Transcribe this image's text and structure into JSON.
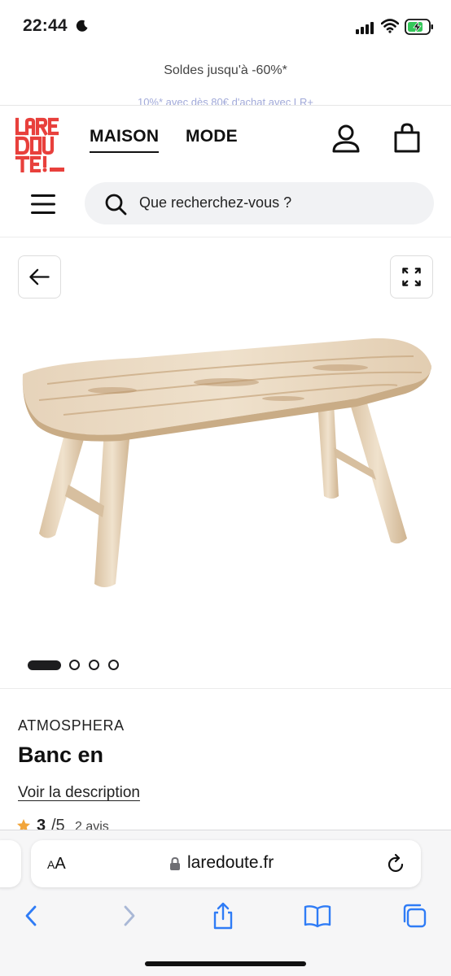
{
  "status_bar": {
    "time": "22:44",
    "icons": [
      "moon-icon",
      "cellular-signal-icon",
      "wifi-icon",
      "battery-charging-icon"
    ]
  },
  "promo": {
    "main": "Soldes jusqu'à -60%*",
    "sub": "10%* avec dès 80€ d'achat avec LR+"
  },
  "header": {
    "logo_text": "LA REDOUTE",
    "tabs": [
      {
        "label": "MAISON",
        "active": true
      },
      {
        "label": "MODE",
        "active": false
      }
    ],
    "icons": [
      "account-icon",
      "shopping-bag-icon",
      "menu-icon"
    ]
  },
  "search": {
    "placeholder": "Que recherchez-vous ?"
  },
  "gallery": {
    "image_subject": "wooden-bench",
    "total_images": 4,
    "active_index": 0,
    "icons": [
      "arrow-left-icon",
      "expand-icon"
    ]
  },
  "product": {
    "brand": "ATMOSPHERA",
    "title": "Banc en",
    "description_link": "Voir la description",
    "rating_score": "3",
    "rating_max": "/5",
    "review_count": "2 avis"
  },
  "browser": {
    "text_size_label": "AA",
    "url": "laredoute.fr",
    "toolbar": [
      "back-icon",
      "forward-icon",
      "share-icon",
      "bookmarks-icon",
      "tabs-icon"
    ]
  },
  "colors": {
    "brand_red": "#e8403c",
    "ios_blue": "#2f7cf6",
    "star": "#f2a53a"
  }
}
